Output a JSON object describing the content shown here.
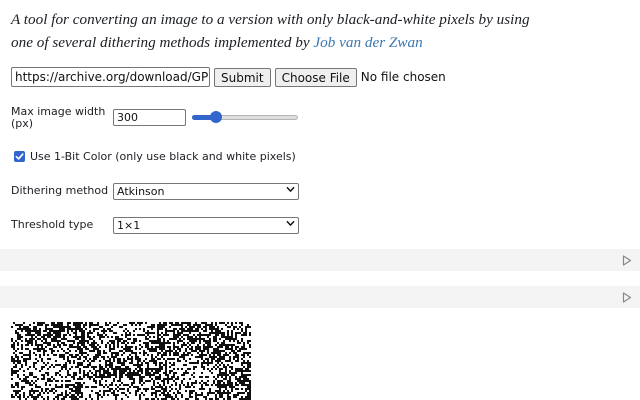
{
  "intro": {
    "text_before_link": "A tool for converting an image to a version with only black-and-white pixels by using one of several dithering methods implemented by ",
    "author_link": "Job van der Zwan"
  },
  "url_row": {
    "url_value": "https://archive.org/download/GPN-2000",
    "submit_label": "Submit",
    "choose_file_label": "Choose File",
    "no_file_text": "No file chosen"
  },
  "width_field": {
    "label": "Max image width (px)",
    "value": "300",
    "slider_fraction": 0.17
  },
  "one_bit": {
    "checked": true,
    "label": "Use 1-Bit Color (only use black and white pixels)"
  },
  "dithering": {
    "label": "Dithering method",
    "selected": "Atkinson"
  },
  "threshold": {
    "label": "Threshold type",
    "selected": "1×1"
  },
  "icons": {
    "cell_run": "play-outline-icon",
    "select_chevron": "chevron-down-icon"
  },
  "colors": {
    "accent": "#3366cc",
    "link": "#3b78b0",
    "cell_bg": "#f4f4f4"
  }
}
